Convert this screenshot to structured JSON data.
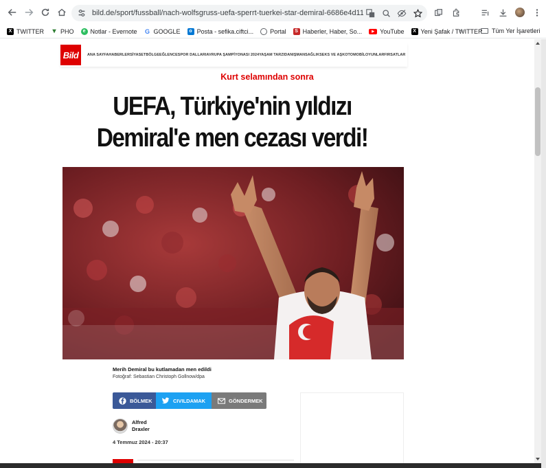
{
  "browser": {
    "url": "bild.de/sport/fussball/nach-wolfsgruss-uefa-sperrt-tuerkei-star-demiral-6686e4d11d5f976aad1...",
    "bookmarks": [
      {
        "label": "TWITTER",
        "icon": "x-icon",
        "color": "#000000"
      },
      {
        "label": "PHO",
        "icon": "leaf-icon",
        "color": "#2e7d32"
      },
      {
        "label": "Notlar - Evernote",
        "icon": "evernote-icon",
        "color": "#2dbe60"
      },
      {
        "label": "GOOGLE",
        "icon": "google-icon",
        "color": "#4285f4"
      },
      {
        "label": "Posta - sefika.ciftci...",
        "icon": "outlook-icon",
        "color": "#0078d4"
      },
      {
        "label": "Portal",
        "icon": "globe-icon",
        "color": "#5f6368"
      },
      {
        "label": "Haberler, Haber, So...",
        "icon": "news-icon",
        "color": "#c62828"
      },
      {
        "label": "YouTube",
        "icon": "youtube-icon",
        "color": "#ff0000"
      },
      {
        "label": "Yeni Şafak / TWITTER",
        "icon": "x-icon",
        "color": "#000000"
      }
    ],
    "bookmarks_more": "»",
    "all_bookmarks": "Tüm Yer İşaretleri"
  },
  "site": {
    "logo": "Bild",
    "nav": [
      "ANA SAYFA",
      "HABERLER",
      "SİYASET",
      "BÖLGE",
      "EĞLENCE",
      "SPOR DALLARI",
      "AVRUPA ŞAMPİYONASI 2024",
      "YAŞAM TARZI",
      "DANIŞMAN",
      "SAĞLIK",
      "SEKS VE AŞK",
      "OTOMOBİL",
      "OYUNLAR",
      "FIRSATLAR"
    ],
    "nav_text": "ANA SAYFAHABERLERSİYASETBÖLGEEĞLENCESPOR DALLARIAVRUPA ŞAMPİYONASI 2024YAŞAM TARZIDANIŞMANSAĞLIKSEKS VE AŞKOTOMOBİLOYUNLARFIRSATLAR"
  },
  "article": {
    "kicker": "Kurt selamından sonra",
    "headline_line1": "UEFA, Türkiye'nin yıldızı",
    "headline_line2": "Demiral'e men cezası verdi!",
    "caption": "Merih Demiral bu kutlamadan men edildi",
    "credit": "Fotoğraf: Sebastian Christoph Gollnow/dpa",
    "share": {
      "facebook": "BÖLMEK",
      "twitter": "CIVILDAMAK",
      "email": "GÖNDERMEK"
    },
    "author_first": "Alfred",
    "author_last": "Draxler",
    "date": "4 Temmuz 2024 - 20:37"
  },
  "colors": {
    "brand_red": "#de0000",
    "facebook": "#3b5998",
    "twitter": "#1da1f2",
    "email": "#7a7a7a"
  }
}
